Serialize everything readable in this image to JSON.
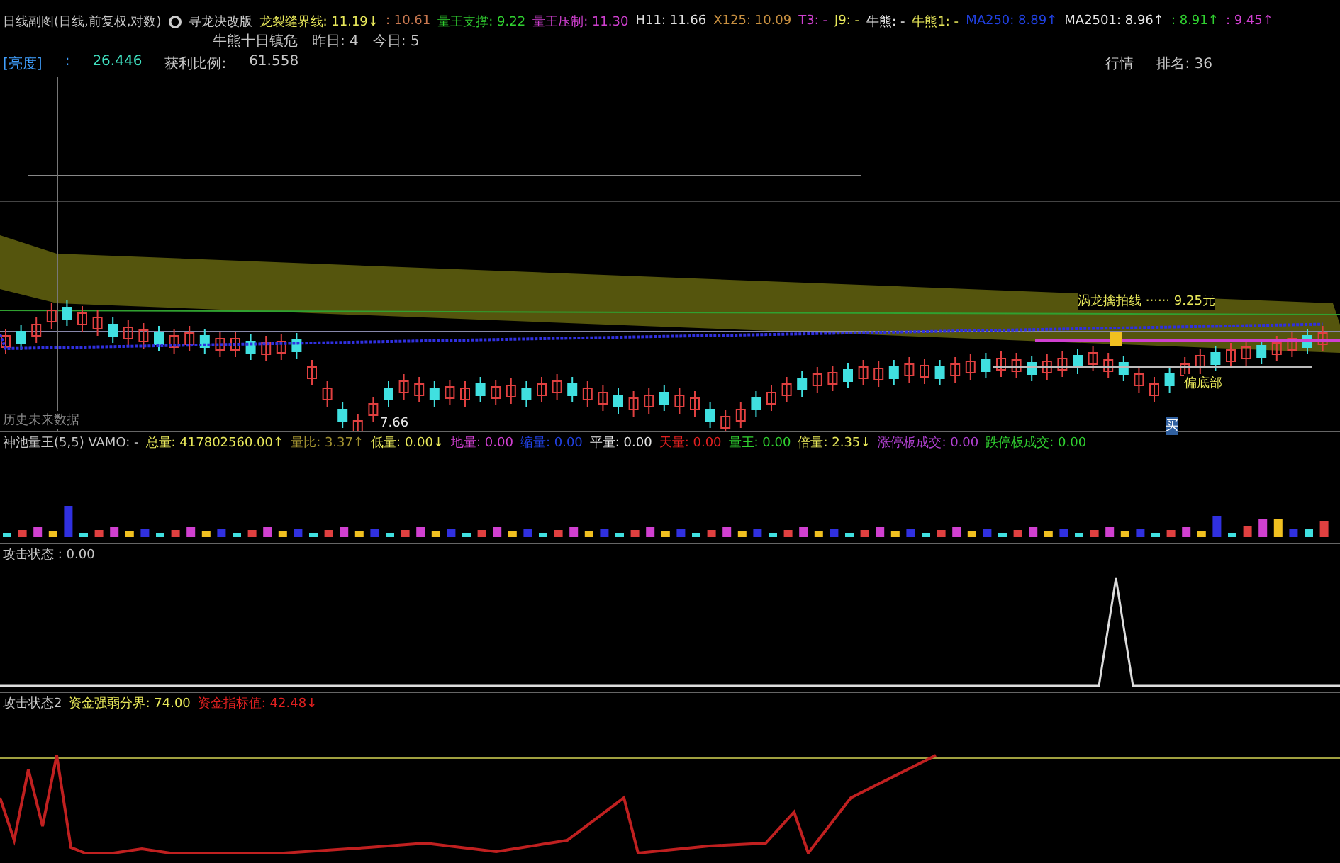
{
  "main_pane": {
    "header": [
      {
        "text": "日线副图(日线,前复权,对数)",
        "color": "#c8c8c8"
      },
      {
        "text": "寻龙决改版",
        "color": "#c8c8c8"
      },
      {
        "text": "龙裂缝界线: 11.19↓",
        "color": "#e8e85a"
      },
      {
        "text": ": 10.61",
        "color": "#c87850"
      },
      {
        "text": "量王支撑: 9.22",
        "color": "#30d030"
      },
      {
        "text": "量王压制: 11.30",
        "color": "#d040d0"
      },
      {
        "text": "H11: 11.66",
        "color": "#e0e0e0"
      },
      {
        "text": "X125: 10.09",
        "color": "#c89040"
      },
      {
        "text": "T3: -",
        "color": "#d040d0"
      },
      {
        "text": "J9: -",
        "color": "#e8e85a"
      },
      {
        "text": "牛熊: -",
        "color": "#e8e8e8"
      },
      {
        "text": "牛熊1: -",
        "color": "#e8e85a"
      },
      {
        "text": "MA250: 8.89↑",
        "color": "#2040e0"
      },
      {
        "text": "MA2501: 8.96↑",
        "color": "#e8e8e8"
      },
      {
        "text": ": 8.91↑",
        "color": "#30d030"
      },
      {
        "text": ": 9.45↑",
        "color": "#d040d0"
      }
    ],
    "line2": [
      "牛熊十日镇危",
      "昨日: 4",
      "今日: 5"
    ],
    "stats_left": [
      {
        "text": "[亮度]",
        "color": "#40a0ff"
      },
      {
        "text": ":",
        "color": "#40a0ff"
      },
      {
        "text": "26.446",
        "color": "#40e0c0"
      },
      {
        "text": "获利比例:",
        "color": "#c8c8c8"
      },
      {
        "text": "61.558",
        "color": "#c8c8c8"
      }
    ],
    "stats_right": [
      "行情",
      "排名: 36"
    ],
    "chart_labels": [
      "涡龙擒拍线 ······ 9.25元",
      "偏底部",
      "历史未来数据",
      "7.66",
      "买"
    ]
  },
  "volume_pane": {
    "header": [
      {
        "text": "神池量王(5,5) VAMO: -",
        "color": "#c8c8c8"
      },
      {
        "text": "总量: 417802560.00↑",
        "color": "#e8e85a"
      },
      {
        "text": "量比: 3.37↑",
        "color": "#a09030"
      },
      {
        "text": "低量: 0.00↓",
        "color": "#e8e85a"
      },
      {
        "text": "地量: 0.00",
        "color": "#d040d0"
      },
      {
        "text": "缩量: 0.00",
        "color": "#2040e0"
      },
      {
        "text": "平量: 0.00",
        "color": "#e8e8e8"
      },
      {
        "text": "天量: 0.00",
        "color": "#e02020"
      },
      {
        "text": "量王: 0.00",
        "color": "#30d030"
      },
      {
        "text": "倍量: 2.35↓",
        "color": "#e8e85a"
      },
      {
        "text": "涨停板成交: 0.00",
        "color": "#b040d0"
      },
      {
        "text": "跌停板成交: 0.00",
        "color": "#30d030"
      }
    ]
  },
  "attack_pane": {
    "header": [
      {
        "text": "攻击状态 : 0.00",
        "color": "#c8c8c8"
      }
    ]
  },
  "attack2_pane": {
    "header": [
      {
        "text": "攻击状态2",
        "color": "#c8c8c8"
      },
      {
        "text": "资金强弱分界: 74.00",
        "color": "#e8e85a"
      },
      {
        "text": "资金指标值: 42.48↓",
        "color": "#e02020"
      }
    ]
  }
}
